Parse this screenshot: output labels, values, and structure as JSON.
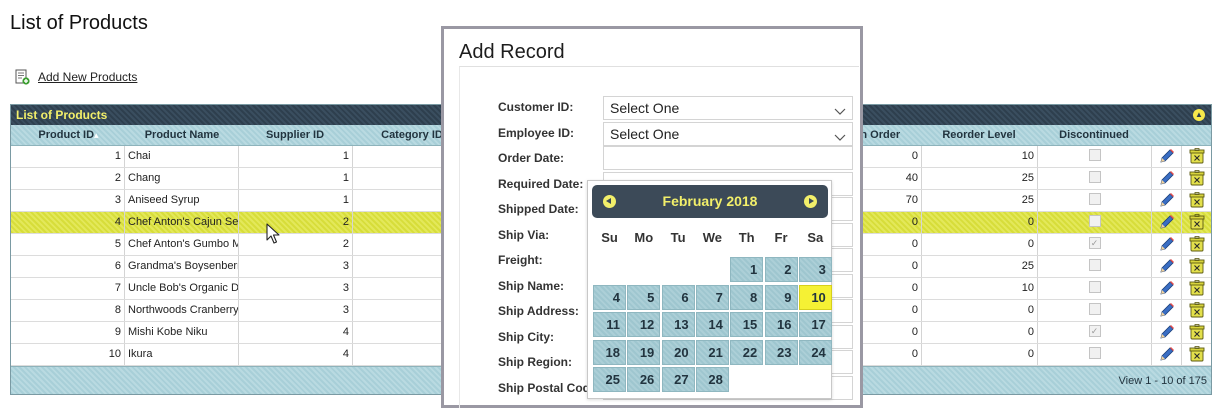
{
  "page": {
    "title": "List of Products",
    "add_link": "Add New Products"
  },
  "grid": {
    "caption": "List of Products",
    "columns": [
      "Product ID",
      "Product Name",
      "Supplier ID",
      "Category ID",
      "On Order",
      "Reorder Level",
      "Discontinued"
    ],
    "rows": [
      {
        "id": "1",
        "name": "Chai",
        "supplier": "1",
        "on_order": "0",
        "reorder": "10",
        "discontinued": false
      },
      {
        "id": "2",
        "name": "Chang",
        "supplier": "1",
        "on_order": "40",
        "reorder": "25",
        "discontinued": false
      },
      {
        "id": "3",
        "name": "Aniseed Syrup",
        "supplier": "1",
        "on_order": "70",
        "reorder": "25",
        "discontinued": false
      },
      {
        "id": "4",
        "name": "Chef Anton's Cajun Se",
        "supplier": "2",
        "on_order": "0",
        "reorder": "0",
        "discontinued": false
      },
      {
        "id": "5",
        "name": "Chef Anton's Gumbo M",
        "supplier": "2",
        "on_order": "0",
        "reorder": "0",
        "discontinued": true
      },
      {
        "id": "6",
        "name": "Grandma's Boysenberr",
        "supplier": "3",
        "on_order": "0",
        "reorder": "25",
        "discontinued": false
      },
      {
        "id": "7",
        "name": "Uncle Bob's Organic D",
        "supplier": "3",
        "on_order": "0",
        "reorder": "10",
        "discontinued": false
      },
      {
        "id": "8",
        "name": "Northwoods Cranberry",
        "supplier": "3",
        "on_order": "0",
        "reorder": "0",
        "discontinued": false
      },
      {
        "id": "9",
        "name": "Mishi Kobe Niku",
        "supplier": "4",
        "on_order": "0",
        "reorder": "0",
        "discontinued": true
      },
      {
        "id": "10",
        "name": "Ikura",
        "supplier": "4",
        "on_order": "0",
        "reorder": "0",
        "discontinued": false
      }
    ],
    "selected_row": 3,
    "footer_info": "View 1 - 10 of 175"
  },
  "modal": {
    "title": "Add Record",
    "fields": [
      {
        "label": "Customer ID:",
        "type": "select",
        "value": "Select One"
      },
      {
        "label": "Employee ID:",
        "type": "select",
        "value": "Select One"
      },
      {
        "label": "Order Date:",
        "type": "input",
        "value": ""
      },
      {
        "label": "Required Date:",
        "type": "input",
        "value": ""
      },
      {
        "label": "Shipped Date:",
        "type": "input",
        "value": ""
      },
      {
        "label": "Ship Via:",
        "type": "input",
        "value": ""
      },
      {
        "label": "Freight:",
        "type": "input",
        "value": ""
      },
      {
        "label": "Ship Name:",
        "type": "input",
        "value": ""
      },
      {
        "label": "Ship Address:",
        "type": "input",
        "value": ""
      },
      {
        "label": "Ship City:",
        "type": "input",
        "value": ""
      },
      {
        "label": "Ship Region:",
        "type": "input",
        "value": ""
      },
      {
        "label": "Ship Postal Code:",
        "type": "input",
        "value": ""
      }
    ]
  },
  "datepicker": {
    "month_label": "February 2018",
    "weekdays": [
      "Su",
      "Mo",
      "Tu",
      "We",
      "Th",
      "Fr",
      "Sa"
    ],
    "first_weekday_index": 4,
    "days_in_month": 28,
    "today": 10
  },
  "colors": {
    "accent_yellow": "#f2ef6a",
    "header_dark": "#2e3f4e",
    "grid_teal": "#a8cfd8",
    "selected_row": "#d7dd3a",
    "today_highlight": "#f5f134"
  }
}
